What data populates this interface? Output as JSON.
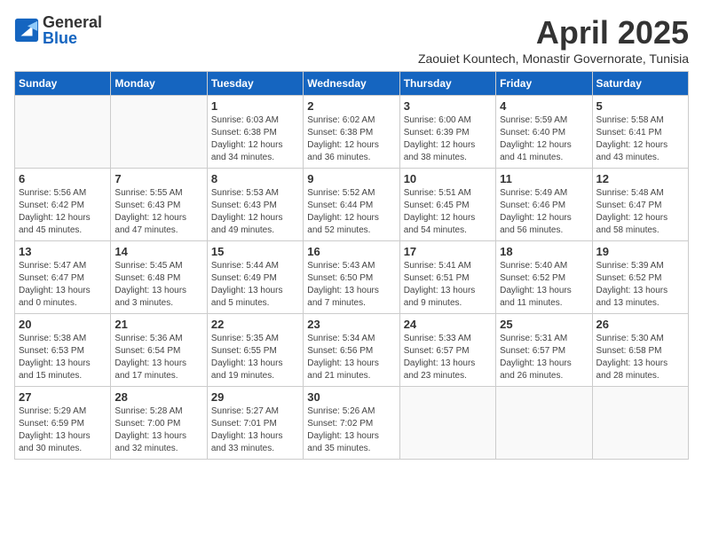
{
  "header": {
    "logo_general": "General",
    "logo_blue": "Blue",
    "month": "April 2025",
    "location": "Zaouiet Kountech, Monastir Governorate, Tunisia"
  },
  "weekdays": [
    "Sunday",
    "Monday",
    "Tuesday",
    "Wednesday",
    "Thursday",
    "Friday",
    "Saturday"
  ],
  "weeks": [
    [
      {
        "day": "",
        "detail": ""
      },
      {
        "day": "",
        "detail": ""
      },
      {
        "day": "1",
        "detail": "Sunrise: 6:03 AM\nSunset: 6:38 PM\nDaylight: 12 hours\nand 34 minutes."
      },
      {
        "day": "2",
        "detail": "Sunrise: 6:02 AM\nSunset: 6:38 PM\nDaylight: 12 hours\nand 36 minutes."
      },
      {
        "day": "3",
        "detail": "Sunrise: 6:00 AM\nSunset: 6:39 PM\nDaylight: 12 hours\nand 38 minutes."
      },
      {
        "day": "4",
        "detail": "Sunrise: 5:59 AM\nSunset: 6:40 PM\nDaylight: 12 hours\nand 41 minutes."
      },
      {
        "day": "5",
        "detail": "Sunrise: 5:58 AM\nSunset: 6:41 PM\nDaylight: 12 hours\nand 43 minutes."
      }
    ],
    [
      {
        "day": "6",
        "detail": "Sunrise: 5:56 AM\nSunset: 6:42 PM\nDaylight: 12 hours\nand 45 minutes."
      },
      {
        "day": "7",
        "detail": "Sunrise: 5:55 AM\nSunset: 6:43 PM\nDaylight: 12 hours\nand 47 minutes."
      },
      {
        "day": "8",
        "detail": "Sunrise: 5:53 AM\nSunset: 6:43 PM\nDaylight: 12 hours\nand 49 minutes."
      },
      {
        "day": "9",
        "detail": "Sunrise: 5:52 AM\nSunset: 6:44 PM\nDaylight: 12 hours\nand 52 minutes."
      },
      {
        "day": "10",
        "detail": "Sunrise: 5:51 AM\nSunset: 6:45 PM\nDaylight: 12 hours\nand 54 minutes."
      },
      {
        "day": "11",
        "detail": "Sunrise: 5:49 AM\nSunset: 6:46 PM\nDaylight: 12 hours\nand 56 minutes."
      },
      {
        "day": "12",
        "detail": "Sunrise: 5:48 AM\nSunset: 6:47 PM\nDaylight: 12 hours\nand 58 minutes."
      }
    ],
    [
      {
        "day": "13",
        "detail": "Sunrise: 5:47 AM\nSunset: 6:47 PM\nDaylight: 13 hours\nand 0 minutes."
      },
      {
        "day": "14",
        "detail": "Sunrise: 5:45 AM\nSunset: 6:48 PM\nDaylight: 13 hours\nand 3 minutes."
      },
      {
        "day": "15",
        "detail": "Sunrise: 5:44 AM\nSunset: 6:49 PM\nDaylight: 13 hours\nand 5 minutes."
      },
      {
        "day": "16",
        "detail": "Sunrise: 5:43 AM\nSunset: 6:50 PM\nDaylight: 13 hours\nand 7 minutes."
      },
      {
        "day": "17",
        "detail": "Sunrise: 5:41 AM\nSunset: 6:51 PM\nDaylight: 13 hours\nand 9 minutes."
      },
      {
        "day": "18",
        "detail": "Sunrise: 5:40 AM\nSunset: 6:52 PM\nDaylight: 13 hours\nand 11 minutes."
      },
      {
        "day": "19",
        "detail": "Sunrise: 5:39 AM\nSunset: 6:52 PM\nDaylight: 13 hours\nand 13 minutes."
      }
    ],
    [
      {
        "day": "20",
        "detail": "Sunrise: 5:38 AM\nSunset: 6:53 PM\nDaylight: 13 hours\nand 15 minutes."
      },
      {
        "day": "21",
        "detail": "Sunrise: 5:36 AM\nSunset: 6:54 PM\nDaylight: 13 hours\nand 17 minutes."
      },
      {
        "day": "22",
        "detail": "Sunrise: 5:35 AM\nSunset: 6:55 PM\nDaylight: 13 hours\nand 19 minutes."
      },
      {
        "day": "23",
        "detail": "Sunrise: 5:34 AM\nSunset: 6:56 PM\nDaylight: 13 hours\nand 21 minutes."
      },
      {
        "day": "24",
        "detail": "Sunrise: 5:33 AM\nSunset: 6:57 PM\nDaylight: 13 hours\nand 23 minutes."
      },
      {
        "day": "25",
        "detail": "Sunrise: 5:31 AM\nSunset: 6:57 PM\nDaylight: 13 hours\nand 26 minutes."
      },
      {
        "day": "26",
        "detail": "Sunrise: 5:30 AM\nSunset: 6:58 PM\nDaylight: 13 hours\nand 28 minutes."
      }
    ],
    [
      {
        "day": "27",
        "detail": "Sunrise: 5:29 AM\nSunset: 6:59 PM\nDaylight: 13 hours\nand 30 minutes."
      },
      {
        "day": "28",
        "detail": "Sunrise: 5:28 AM\nSunset: 7:00 PM\nDaylight: 13 hours\nand 32 minutes."
      },
      {
        "day": "29",
        "detail": "Sunrise: 5:27 AM\nSunset: 7:01 PM\nDaylight: 13 hours\nand 33 minutes."
      },
      {
        "day": "30",
        "detail": "Sunrise: 5:26 AM\nSunset: 7:02 PM\nDaylight: 13 hours\nand 35 minutes."
      },
      {
        "day": "",
        "detail": ""
      },
      {
        "day": "",
        "detail": ""
      },
      {
        "day": "",
        "detail": ""
      }
    ]
  ]
}
